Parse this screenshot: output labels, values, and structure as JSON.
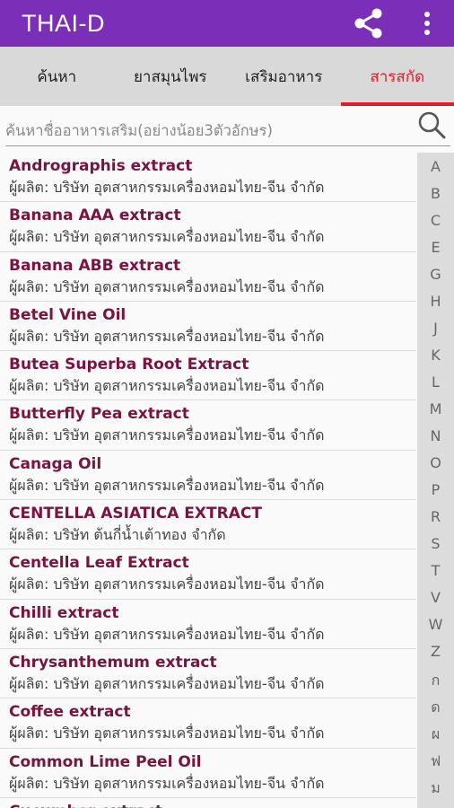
{
  "appbar": {
    "title": "THAI-D",
    "share_icon": "share-icon",
    "more_icon": "more-vert-icon",
    "color": "#7b2fb8"
  },
  "tabs": [
    {
      "label": "ค้นหา",
      "active": false
    },
    {
      "label": "ยาสมุนไพร",
      "active": false
    },
    {
      "label": "เสริมอาหาร",
      "active": false
    },
    {
      "label": "สารสกัด",
      "active": true
    }
  ],
  "search": {
    "placeholder": "ค้นหาชื่ออาหารเสริม(อย่างน้อย3ตัวอักษร)",
    "value": ""
  },
  "items": [
    {
      "name": "Andrographis extract",
      "maker": "ผู้ผลิต: บริษัท อุตสาหกรรมเครื่องหอมไทย-จีน จำกัด"
    },
    {
      "name": "Banana AAA extract",
      "maker": "ผู้ผลิต: บริษัท อุตสาหกรรมเครื่องหอมไทย-จีน จำกัด"
    },
    {
      "name": "Banana ABB extract",
      "maker": "ผู้ผลิต: บริษัท อุตสาหกรรมเครื่องหอมไทย-จีน จำกัด"
    },
    {
      "name": "Betel Vine Oil",
      "maker": "ผู้ผลิต: บริษัท อุตสาหกรรมเครื่องหอมไทย-จีน จำกัด"
    },
    {
      "name": "Butea Superba Root Extract",
      "maker": "ผู้ผลิต: บริษัท อุตสาหกรรมเครื่องหอมไทย-จีน จำกัด"
    },
    {
      "name": "Butterfly Pea extract",
      "maker": "ผู้ผลิต: บริษัท อุตสาหกรรมเครื่องหอมไทย-จีน จำกัด"
    },
    {
      "name": "Canaga Oil",
      "maker": "ผู้ผลิต: บริษัท อุตสาหกรรมเครื่องหอมไทย-จีน จำกัด"
    },
    {
      "name": "CENTELLA ASIATICA EXTRACT",
      "maker": "ผู้ผลิต: บริษัท ต้นกี่น้ำเต้าทอง จำกัด"
    },
    {
      "name": "Centella Leaf Extract",
      "maker": "ผู้ผลิต: บริษัท อุตสาหกรรมเครื่องหอมไทย-จีน จำกัด"
    },
    {
      "name": "Chilli extract",
      "maker": "ผู้ผลิต: บริษัท อุตสาหกรรมเครื่องหอมไทย-จีน จำกัด"
    },
    {
      "name": "Chrysanthemum extract",
      "maker": "ผู้ผลิต: บริษัท อุตสาหกรรมเครื่องหอมไทย-จีน จำกัด"
    },
    {
      "name": "Coffee extract",
      "maker": "ผู้ผลิต: บริษัท อุตสาหกรรมเครื่องหอมไทย-จีน จำกัด"
    },
    {
      "name": "Common Lime Peel Oil",
      "maker": "ผู้ผลิต: บริษัท อุตสาหกรรมเครื่องหอมไทย-จีน จำกัด"
    },
    {
      "name": "Cucumber extract",
      "maker": ""
    }
  ],
  "index_letters": [
    "A",
    "B",
    "C",
    "E",
    "G",
    "H",
    "J",
    "K",
    "L",
    "M",
    "N",
    "O",
    "P",
    "R",
    "S",
    "T",
    "V",
    "W",
    "Z",
    "ก",
    "ด",
    "ผ",
    "ฟ",
    "ม"
  ],
  "colors": {
    "accent": "#e01e2b",
    "item_name": "#7a1340"
  }
}
